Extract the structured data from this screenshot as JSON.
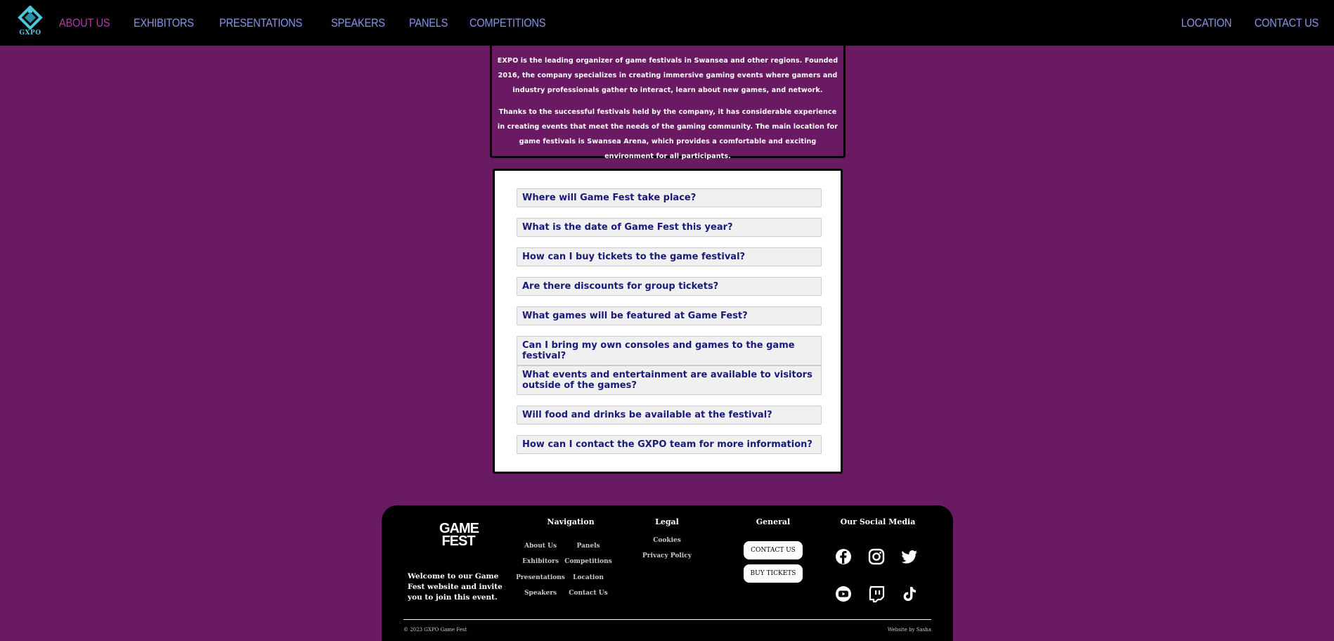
{
  "header": {
    "logo_text": "GXPO",
    "nav_left": [
      "ABOUT US",
      "EXHIBITORS",
      "PRESENTATIONS",
      "SPEAKERS",
      "PANELS",
      "COMPETITIONS"
    ],
    "nav_right": [
      "LOCATION",
      "CONTACT US"
    ],
    "active": "ABOUT US"
  },
  "about": {
    "paragraph1": "EXPO is the leading organizer of game festivals in Swansea and other regions. Founded 2016, the company specializes in creating immersive gaming events where gamers and industry professionals gather to interact, learn about new games, and network.",
    "paragraph2": "Thanks to the successful festivals held by the company, it has considerable experience in creating events that meet the needs of the gaming community. The main location for game festivals is Swansea Arena, which provides a comfortable and exciting environment for all participants."
  },
  "faq": [
    "Where will Game Fest take place?",
    "What is the date of Game Fest this year?",
    "How can I buy tickets to the game festival?",
    "Are there discounts for group tickets?",
    "What games will be featured at Game Fest?",
    "Can I bring my own consoles and games to the game festival?",
    "What events and entertainment are available to visitors outside of the games?",
    "Will food and drinks be available at the festival?",
    "How can I contact the GXPO team for more information?"
  ],
  "footer": {
    "logo_line1": "GAME",
    "logo_line2": "FEST",
    "welcome": "Welcome to our Game Fest website and invite you to join this event.",
    "nav_heading": "Navigation",
    "nav_links": [
      "About Us",
      "Panels",
      "Exhibitors",
      "Competitions",
      "Presentations",
      "Location",
      "Speakers",
      "Contact Us"
    ],
    "legal_heading": "Legal",
    "legal_links": [
      "Cookies",
      "Privacy Policy"
    ],
    "general_heading": "General",
    "contact_button": "CONTACT US",
    "tickets_button": "BUY TICKETS",
    "social_heading": "Our Social Media",
    "social_icons": [
      "facebook-icon",
      "instagram-icon",
      "twitter-icon",
      "youtube-icon",
      "twitch-icon",
      "tiktok-icon"
    ],
    "copyright": "© 2023 GXPO Game Fest",
    "credit": "Website by Sasha"
  },
  "colors": {
    "background": "#6a1a63",
    "nav_link": "#8a94e6",
    "nav_active": "#b33aa6",
    "faq_text": "#1a1a7a",
    "logo": "#4ec7d6"
  }
}
